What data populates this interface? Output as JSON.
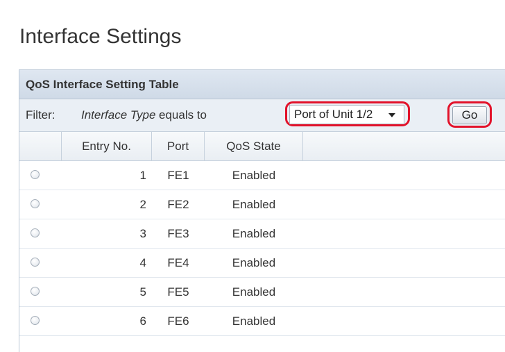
{
  "page": {
    "title": "Interface Settings"
  },
  "table": {
    "caption": "QoS Interface Setting Table",
    "filter": {
      "label": "Filter:",
      "field": "Interface Type",
      "operator": "equals to",
      "selected": "Port of Unit 1/2",
      "go_label": "Go"
    },
    "columns": {
      "entry": "Entry No.",
      "port": "Port",
      "state": "QoS State"
    },
    "rows": [
      {
        "entry": "1",
        "port": "FE1",
        "state": "Enabled"
      },
      {
        "entry": "2",
        "port": "FE2",
        "state": "Enabled"
      },
      {
        "entry": "3",
        "port": "FE3",
        "state": "Enabled"
      },
      {
        "entry": "4",
        "port": "FE4",
        "state": "Enabled"
      },
      {
        "entry": "5",
        "port": "FE5",
        "state": "Enabled"
      },
      {
        "entry": "6",
        "port": "FE6",
        "state": "Enabled"
      }
    ]
  },
  "colors": {
    "highlight": "#e2122a",
    "caption_bg": "#d6e0ec",
    "text": "#333333"
  },
  "icons": {
    "dropdown": "chevron-down-icon",
    "row_selector": "radio-button"
  }
}
